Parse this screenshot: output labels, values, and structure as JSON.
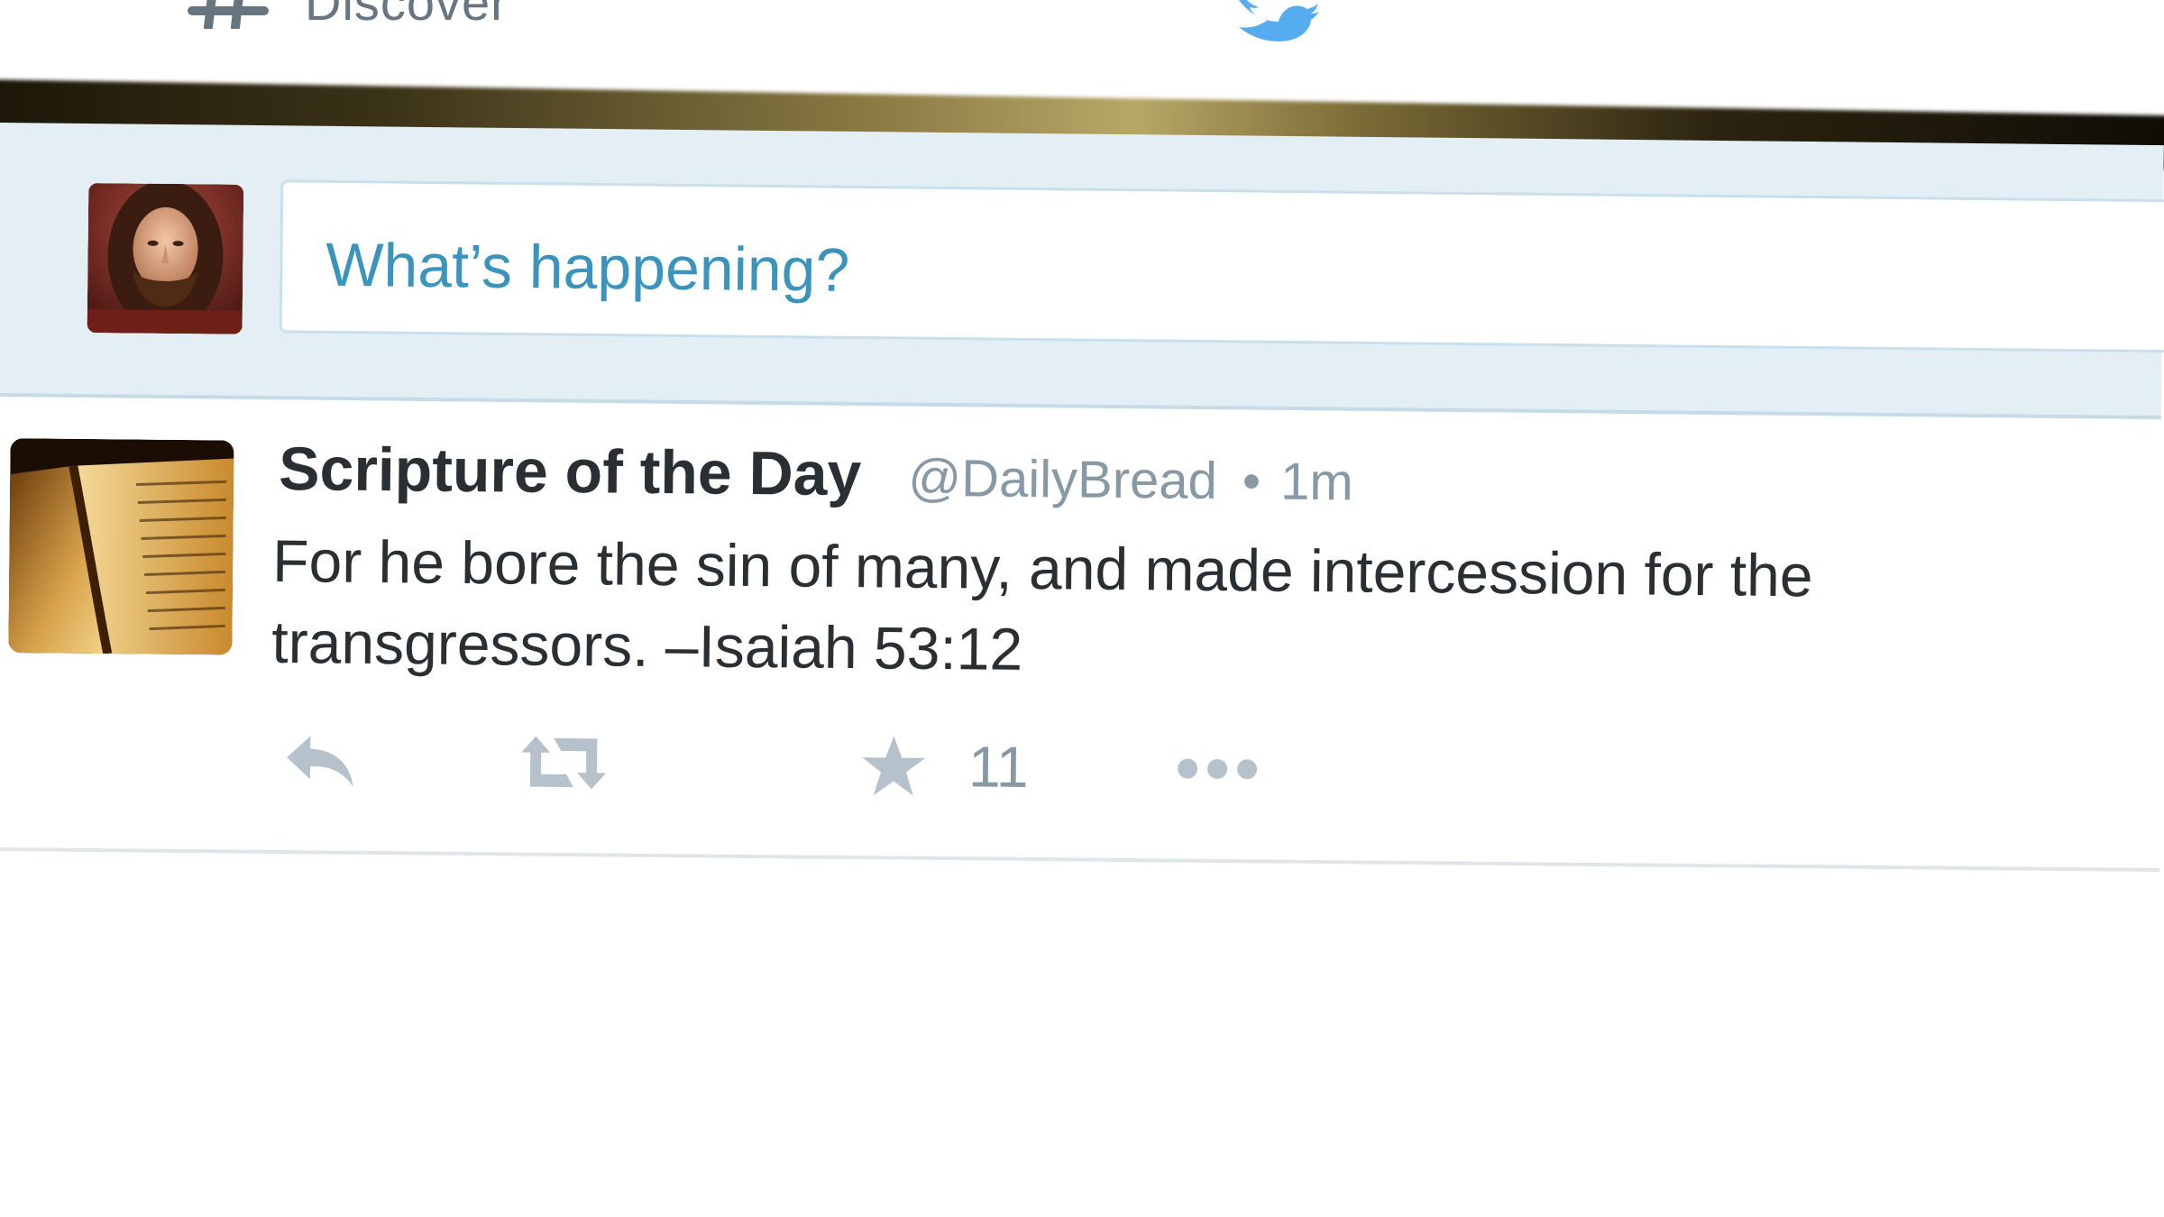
{
  "topnav": {
    "discover_label": "Discover",
    "discover_icon": "hash-icon",
    "logo_icon": "twitter-bird-icon"
  },
  "composer": {
    "placeholder": "What’s happening?",
    "avatar_icon": "user-avatar"
  },
  "tweet": {
    "fullname": "Scripture of the Day",
    "username": "@DailyBread",
    "separator": "•",
    "timestamp": "1m",
    "text_line1": "For he bore the sin of many, and made intercession for the",
    "text_line2": "transgressors. –Isaiah 53:12",
    "actions": {
      "reply_icon": "reply-icon",
      "retweet_icon": "retweet-icon",
      "favorite_icon": "star-icon",
      "favorite_count": "11",
      "more_icon": "more-dots-icon"
    }
  },
  "colors": {
    "link_blue": "#3b94be",
    "twitter_blue": "#55acee",
    "text_dark": "#292f33",
    "text_muted": "#8899a6",
    "composer_bg": "#e4eef5",
    "icon_gray": "#b6c2cb"
  }
}
